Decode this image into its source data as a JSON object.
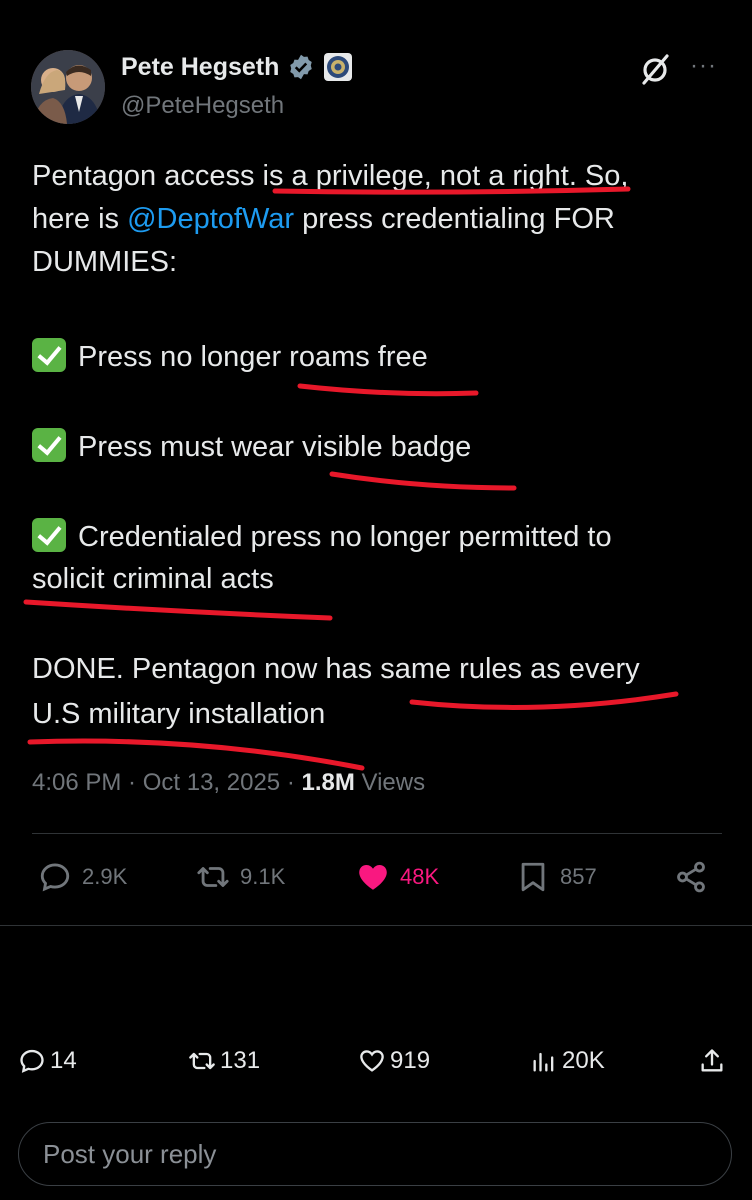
{
  "author": {
    "name": "Pete Hegseth",
    "handle": "@PeteHegseth"
  },
  "header": {
    "grok_icon": "grok-slash-icon",
    "more_icon": "more-horizontal-icon",
    "more_label": "···"
  },
  "tweet": {
    "line1_a": "Pentagon access ",
    "line1_b": "is a privilege, not a right.",
    "line1_c": " So,",
    "line2_a": "here is ",
    "line2_mention": "@DeptofWar",
    "line2_b": " press credentialing FOR",
    "line3": "DUMMIES:",
    "item1": "Press no longer roams free",
    "item2": "Press must wear visible badge",
    "item3_a": "Credentialed press no longer permitted to",
    "item3_b": "solicit criminal acts",
    "done_a": "DONE. Pentagon now has same rules as every",
    "done_b": "U.S military installation"
  },
  "meta": {
    "time": "4:06 PM",
    "sep1": " · ",
    "date": "Oct 13, 2025",
    "sep2": " · ",
    "views_count": "1.8M",
    "views_label": " Views"
  },
  "actions": {
    "replies": "2.9K",
    "reposts": "9.1K",
    "likes": "48K",
    "bookmarks": "857"
  },
  "bottom_bar": {
    "replies": "14",
    "reposts": "131",
    "likes": "919",
    "views": "20K"
  },
  "reply": {
    "placeholder": "Post your reply"
  },
  "colors": {
    "background": "#000000",
    "text": "#e7e9ea",
    "muted": "#71767b",
    "link": "#1d9bf0",
    "like": "#f91880",
    "annotation": "#e8182a",
    "check": "#5ab344"
  }
}
